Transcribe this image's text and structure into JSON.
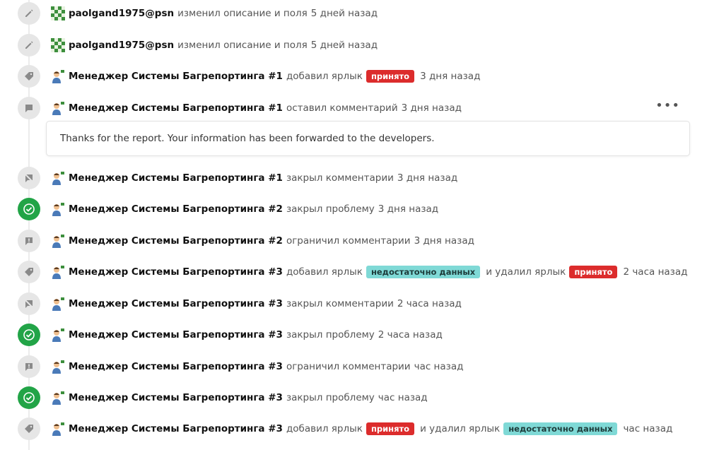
{
  "colors": {
    "label_red": "#dc2c2c",
    "label_teal": "#7fd9d6",
    "closed_green": "#22a447",
    "badge_grey": "#e6e6e6"
  },
  "events": [
    {
      "icon": "pencil-icon",
      "user": "paolgand1975@psn",
      "avatar": "mosaic",
      "action": "изменил описание и поля",
      "time": "5 дней назад"
    },
    {
      "icon": "pencil-icon",
      "user": "paolgand1975@psn",
      "avatar": "mosaic",
      "action": "изменил описание и поля",
      "time": "5 дней назад"
    },
    {
      "icon": "tag-icon",
      "user": "Менеджер Системы Багрепортинга #1",
      "avatar": "bot",
      "action": "добавил ярлык",
      "added_label": "принято",
      "time": "3 дня назад"
    },
    {
      "icon": "comment-icon",
      "user": "Менеджер Системы Багрепортинга #1",
      "avatar": "bot",
      "action": "оставил комментарий",
      "time": "3 дня назад",
      "comment": "Thanks for the report. Your information has been forwarded to the developers.",
      "more": "•••"
    },
    {
      "icon": "comment-locked-icon",
      "user": "Менеджер Системы Багрепортинга #1",
      "avatar": "bot",
      "action": "закрыл комментарии",
      "time": "3 дня назад"
    },
    {
      "icon": "check-circle-icon",
      "user": "Менеджер Системы Багрепортинга #2",
      "avatar": "bot",
      "action": "закрыл проблему",
      "time": "3 дня назад"
    },
    {
      "icon": "comment-restricted-icon",
      "user": "Менеджер Системы Багрепортинга #2",
      "avatar": "bot",
      "action": "ограничил комментарии",
      "time": "3 дня назад"
    },
    {
      "icon": "tag-icon",
      "user": "Менеджер Системы Багрепортинга #3",
      "avatar": "bot",
      "action": "добавил ярлык",
      "added_label": "недостаточно данных",
      "connector": "и удалил ярлык",
      "removed_label": "принято",
      "time": "2 часа назад"
    },
    {
      "icon": "comment-locked-icon",
      "user": "Менеджер Системы Багрепортинга #3",
      "avatar": "bot",
      "action": "закрыл комментарии",
      "time": "2 часа назад"
    },
    {
      "icon": "check-circle-icon",
      "user": "Менеджер Системы Багрепортинга #3",
      "avatar": "bot",
      "action": "закрыл проблему",
      "time": "2 часа назад"
    },
    {
      "icon": "comment-restricted-icon",
      "user": "Менеджер Системы Багрепортинга #3",
      "avatar": "bot",
      "action": "ограничил комментарии",
      "time": "час назад"
    },
    {
      "icon": "check-circle-icon",
      "user": "Менеджер Системы Багрепортинга #3",
      "avatar": "bot",
      "action": "закрыл проблему",
      "time": "час назад"
    },
    {
      "icon": "tag-icon",
      "user": "Менеджер Системы Багрепортинга #3",
      "avatar": "bot",
      "action": "добавил ярлык",
      "added_label": "принято",
      "connector": "и удалил ярлык",
      "removed_label": "недостаточно данных",
      "time": "час назад"
    }
  ]
}
